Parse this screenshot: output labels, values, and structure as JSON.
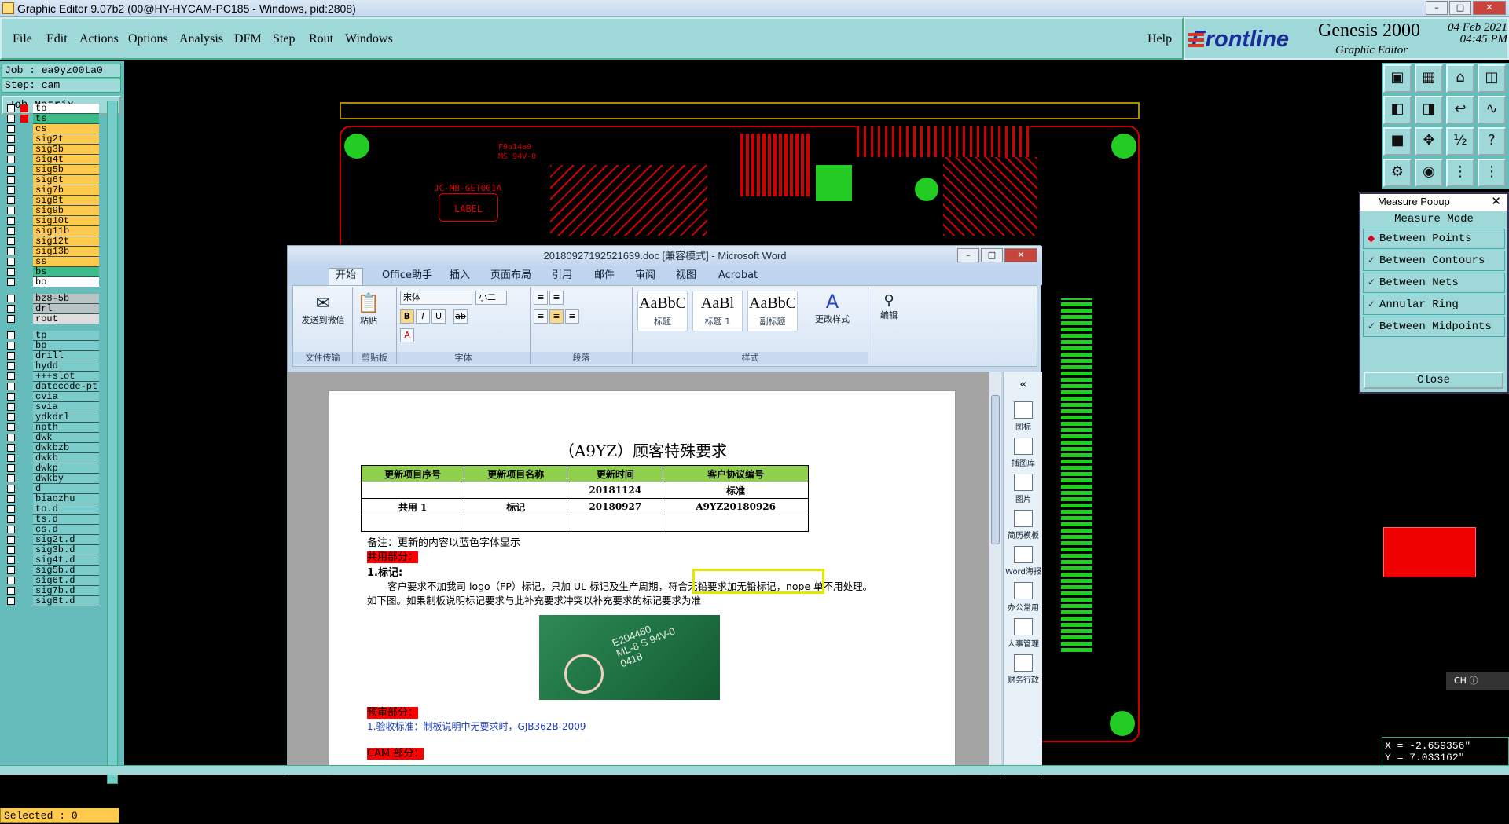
{
  "window": {
    "title": "Graphic Editor 9.07b2 (00@HY-HYCAM-PC185 - Windows, pid:2808)"
  },
  "menu": {
    "items": [
      "File",
      "Edit",
      "Actions",
      "Options",
      "Analysis",
      "DFM",
      "Step",
      "Rout",
      "Windows"
    ],
    "help": "Help"
  },
  "logo": {
    "brand": "Frontline",
    "product": "Genesis 2000",
    "sub": "Graphic Editor",
    "date": "04 Feb 2021",
    "time": "04:45 PM"
  },
  "job": {
    "job": "Job : ea9yz00ta0",
    "step": "Step: cam",
    "matrix": "Job Matrix ..."
  },
  "layers": [
    {
      "name": "to",
      "color": "#ffffff",
      "c2": "#e00"
    },
    {
      "name": "ts",
      "color": "#3dbb8a",
      "c2": "#e00"
    },
    {
      "name": "cs",
      "color": "#ffc94d"
    },
    {
      "name": "sig2t",
      "color": "#ffc94d"
    },
    {
      "name": "sig3b",
      "color": "#ffc94d"
    },
    {
      "name": "sig4t",
      "color": "#ffc94d"
    },
    {
      "name": "sig5b",
      "color": "#ffc94d"
    },
    {
      "name": "sig6t",
      "color": "#ffc94d"
    },
    {
      "name": "sig7b",
      "color": "#ffc94d"
    },
    {
      "name": "sig8t",
      "color": "#ffc94d"
    },
    {
      "name": "sig9b",
      "color": "#ffc94d"
    },
    {
      "name": "sig10t",
      "color": "#ffc94d"
    },
    {
      "name": "sig11b",
      "color": "#ffc94d"
    },
    {
      "name": "sig12t",
      "color": "#ffc94d"
    },
    {
      "name": "sig13b",
      "color": "#ffc94d"
    },
    {
      "name": "ss",
      "color": "#ffc94d"
    },
    {
      "name": "bs",
      "color": "#3dbb8a"
    },
    {
      "name": "bo",
      "color": "#ffffff"
    },
    {
      "name": "bz8-5b",
      "color": "#b8c4c4"
    },
    {
      "name": "drl",
      "color": "#b8c4c4"
    },
    {
      "name": "rout",
      "color": "#dddddd"
    },
    {
      "name": "tp",
      "color": "#7ccccc"
    },
    {
      "name": "bp",
      "color": "#7ccccc"
    },
    {
      "name": "drill",
      "color": "#7ccccc"
    },
    {
      "name": "hydd",
      "color": "#7ccccc"
    },
    {
      "name": "+++slot",
      "color": "#7ccccc"
    },
    {
      "name": "datecode-pt",
      "color": "#7ccccc"
    },
    {
      "name": "cvia",
      "color": "#7ccccc"
    },
    {
      "name": "svia",
      "color": "#7ccccc"
    },
    {
      "name": "ydkdrl",
      "color": "#7ccccc"
    },
    {
      "name": "npth",
      "color": "#7ccccc"
    },
    {
      "name": "dwk",
      "color": "#7ccccc"
    },
    {
      "name": "dwkbzb",
      "color": "#7ccccc"
    },
    {
      "name": "dwkb",
      "color": "#7ccccc"
    },
    {
      "name": "dwkp",
      "color": "#7ccccc"
    },
    {
      "name": "dwkby",
      "color": "#7ccccc"
    },
    {
      "name": "d",
      "color": "#7ccccc"
    },
    {
      "name": "biaozhu",
      "color": "#7ccccc"
    },
    {
      "name": "to.d",
      "color": "#7ccccc"
    },
    {
      "name": "ts.d",
      "color": "#7ccccc"
    },
    {
      "name": "cs.d",
      "color": "#7ccccc"
    },
    {
      "name": "sig2t.d",
      "color": "#7ccccc"
    },
    {
      "name": "sig3b.d",
      "color": "#7ccccc"
    },
    {
      "name": "sig4t.d",
      "color": "#7ccccc"
    },
    {
      "name": "sig5b.d",
      "color": "#7ccccc"
    },
    {
      "name": "sig6t.d",
      "color": "#7ccccc"
    },
    {
      "name": "sig7b.d",
      "color": "#7ccccc"
    },
    {
      "name": "sig8t.d",
      "color": "#7ccccc"
    }
  ],
  "selected": "Selected : 0",
  "measure": {
    "title": "Measure Popup",
    "mode": "Measure Mode",
    "options": [
      "Between Points",
      "Between Contours",
      "Between Nets",
      "Annular Ring",
      "Between Midpoints"
    ],
    "active": 0,
    "close": "Close"
  },
  "coords": {
    "x": "X = -2.659356\"",
    "y": "Y = 7.033162\""
  },
  "ime": "CH",
  "pcb": {
    "text1": "JC-MB-GET001A",
    "text2": "LABEL",
    "text3": "F9a14a9",
    "text4": "MS 94V-0"
  },
  "word": {
    "title": "20180927192521639.doc [兼容模式] - Microsoft Word",
    "tabs": [
      "开始",
      "Office助手",
      "插入",
      "页面布局",
      "引用",
      "邮件",
      "审阅",
      "视图",
      "Acrobat"
    ],
    "groups": [
      "文件传输",
      "剪贴板",
      "字体",
      "段落",
      "样式"
    ],
    "send": "发送到微信",
    "paste": "粘贴",
    "font": "宋体",
    "size": "小二",
    "styles": [
      {
        "preview": "AaBbC",
        "label": "标题"
      },
      {
        "preview": "AaBl",
        "label": "标题 1"
      },
      {
        "preview": "AaBbC",
        "label": "副标题"
      }
    ],
    "change_style": "更改样式",
    "edit": "编辑",
    "side": [
      "图标",
      "插图库",
      "图片",
      "简历模板",
      "Word海报",
      "办公常用",
      "人事管理",
      "财务行政"
    ],
    "doc_title": "（A9YZ）顾客特殊要求",
    "table_head": [
      "更新项目序号",
      "更新项目名称",
      "更新时间",
      "客户协议编号"
    ],
    "rows": [
      [
        "",
        "",
        "20181124",
        "标准"
      ],
      [
        "共用 1",
        "标记",
        "20180927",
        "A9YZ20180926"
      ],
      [
        "",
        "",
        "",
        ""
      ]
    ],
    "note": "备注：更新的内容以蓝色字体显示",
    "sec1": "共用部分：",
    "item1": "1.标记:",
    "para1": "客户要求不加我司 logo（FP）标记，只加 UL 标记及生产周期，符合无铅要求加无铅标记，nope 单不用处理。",
    "para2": "如下图。如果制板说明标记要求与此补充要求冲突以补充要求的标记要求为准",
    "photo": {
      "l1": "E204460",
      "l2": "ML-8 S 94V-0",
      "l3": "0418"
    },
    "sec2": "预审部分：",
    "item2": "1.验收标准：制板说明中无要求时，GJB362B-2009",
    "sec3": "CAM 部分："
  }
}
